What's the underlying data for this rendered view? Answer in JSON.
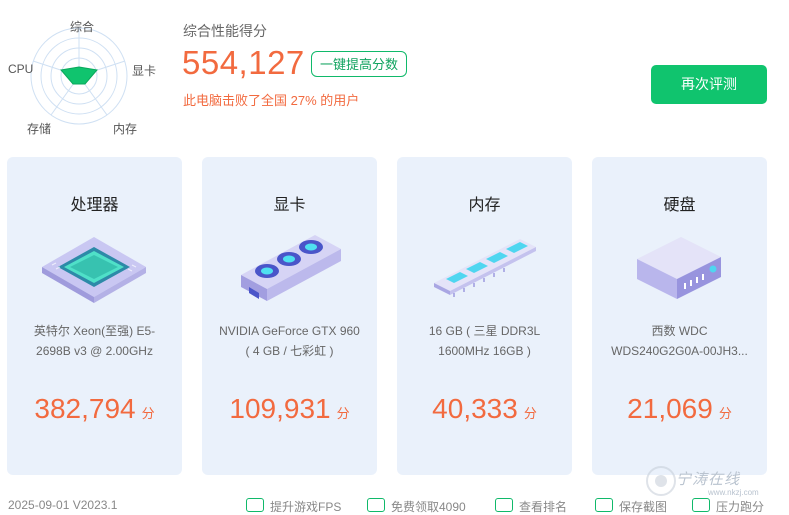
{
  "radar": {
    "labels": {
      "top": "综合",
      "right": "显卡",
      "left": "CPU",
      "bottom_left": "存储",
      "bottom_right": "内存"
    }
  },
  "score": {
    "title": "综合性能得分",
    "value": "554,127",
    "boost_label": "一键提高分数",
    "beat_text": "此电脑击败了全国 27% 的用户"
  },
  "retest_label": "再次评测",
  "cards": [
    {
      "title": "处理器",
      "desc": "英特尔 Xeon(至强) E5-2698B v3 @ 2.00GHz",
      "score": "382,794",
      "unit": "分",
      "icon": "cpu-chip-icon"
    },
    {
      "title": "显卡",
      "desc": "NVIDIA GeForce GTX 960 ( 4 GB / 七彩虹 )",
      "score": "109,931",
      "unit": "分",
      "icon": "graphics-card-icon"
    },
    {
      "title": "内存",
      "desc": "16 GB ( 三星 DDR3L 1600MHz 16GB )",
      "score": "40,333",
      "unit": "分",
      "icon": "memory-stick-icon"
    },
    {
      "title": "硬盘",
      "desc": "西数 WDC WDS240G2G0A-00JH3...",
      "score": "21,069",
      "unit": "分",
      "icon": "hard-drive-icon"
    }
  ],
  "footer": {
    "date_version": "2025-09-01 V2023.1",
    "links": [
      "提升游戏FPS",
      "免费领取4090",
      "查看排名",
      "保存截图",
      "压力跑分"
    ]
  },
  "watermark": {
    "text": "宁涛在线",
    "url": "www.nkzj.com"
  },
  "colors": {
    "accent_green": "#10c46e",
    "score_orange": "#f26a3f",
    "card_bg": "#eaf1fb"
  }
}
